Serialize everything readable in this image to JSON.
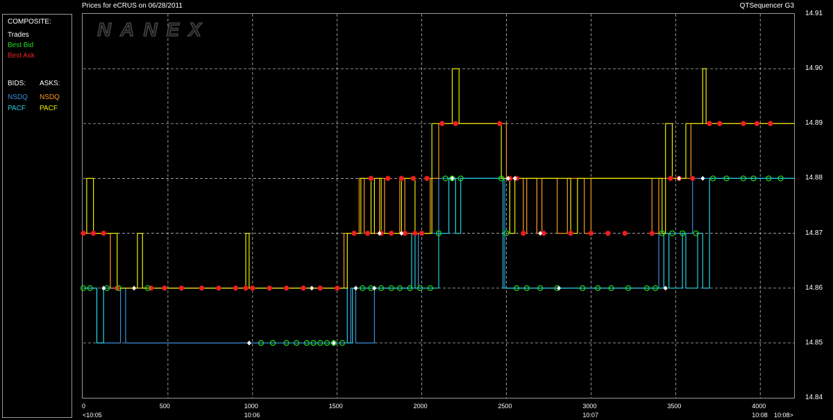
{
  "header": {
    "title_left": "Prices for  eCRUS  on  06/28/2011",
    "title_right": "QTSequencer G3"
  },
  "watermark": "NANEX",
  "legend": {
    "composite_title": "COMPOSITE:",
    "trades": "Trades",
    "best_bid": "Best Bid",
    "best_ask": "Best Ask",
    "bids_title": "BIDS:",
    "asks_title": "ASKS:",
    "bid_nsdq": "NSDQ",
    "bid_pacf": "PACF",
    "ask_nsdq": "NSDQ",
    "ask_pacf": "PACF"
  },
  "colors": {
    "trades": "#ffffff",
    "best_bid": "#22dd22",
    "best_ask": "#ee2222",
    "bid_nsdq": "#3a8fe0",
    "bid_pacf": "#22d0e0",
    "ask_nsdq": "#ff9a22",
    "ask_pacf": "#f0f000"
  },
  "chart_data": {
    "type": "line",
    "title": "Prices for  eCRUS  on  06/28/2011",
    "xlim": [
      0,
      4200
    ],
    "ylim": [
      14.84,
      14.91
    ],
    "grid": true,
    "y_ticks": [
      "14.84",
      "14.85",
      "14.86",
      "14.87",
      "14.88",
      "14.89",
      "14.90",
      "14.91"
    ],
    "x_ticks": [
      {
        "value": 0,
        "label": "0",
        "time": "<10:05"
      },
      {
        "value": 500,
        "label": "500",
        "time": ""
      },
      {
        "value": 1000,
        "label": "1000",
        "time": "10:06"
      },
      {
        "value": 1500,
        "label": "1500",
        "time": ""
      },
      {
        "value": 2000,
        "label": "2000",
        "time": ""
      },
      {
        "value": 2500,
        "label": "2500",
        "time": ""
      },
      {
        "value": 3000,
        "label": "3000",
        "time": "10:07"
      },
      {
        "value": 3500,
        "label": "3500",
        "time": ""
      },
      {
        "value": 4000,
        "label": "4000",
        "time": "10:08"
      }
    ],
    "x_end_label": "10:08>",
    "series": [
      {
        "name": "NSDQ",
        "key": "bid_nsdq",
        "points": [
          [
            0,
            14.86
          ],
          [
            80,
            14.86
          ],
          [
            80,
            14.85
          ],
          [
            220,
            14.85
          ],
          [
            220,
            14.86
          ],
          [
            250,
            14.86
          ],
          [
            250,
            14.85
          ],
          [
            1580,
            14.85
          ],
          [
            1580,
            14.86
          ],
          [
            1610,
            14.86
          ],
          [
            1610,
            14.85
          ],
          [
            1720,
            14.85
          ],
          [
            1720,
            14.86
          ],
          [
            1980,
            14.86
          ],
          [
            1980,
            14.87
          ],
          [
            2050,
            14.87
          ],
          [
            2050,
            14.87
          ],
          [
            2100,
            14.87
          ],
          [
            2100,
            14.88
          ],
          [
            2490,
            14.88
          ],
          [
            2490,
            14.86
          ],
          [
            2520,
            14.86
          ],
          [
            3400,
            14.86
          ],
          [
            3400,
            14.87
          ],
          [
            3600,
            14.87
          ],
          [
            3600,
            14.88
          ],
          [
            4200,
            14.88
          ]
        ]
      },
      {
        "name": "PACF",
        "key": "bid_pacf",
        "points": [
          [
            0,
            14.86
          ],
          [
            80,
            14.86
          ],
          [
            80,
            14.85
          ],
          [
            120,
            14.85
          ],
          [
            120,
            14.86
          ],
          [
            1560,
            14.86
          ],
          [
            1560,
            14.85
          ],
          [
            1590,
            14.85
          ],
          [
            1590,
            14.86
          ],
          [
            1940,
            14.86
          ],
          [
            1940,
            14.87
          ],
          [
            1960,
            14.87
          ],
          [
            1960,
            14.86
          ],
          [
            2100,
            14.86
          ],
          [
            2100,
            14.87
          ],
          [
            2160,
            14.87
          ],
          [
            2160,
            14.88
          ],
          [
            2200,
            14.88
          ],
          [
            2200,
            14.87
          ],
          [
            2230,
            14.87
          ],
          [
            2230,
            14.88
          ],
          [
            2480,
            14.88
          ],
          [
            2480,
            14.86
          ],
          [
            3430,
            14.86
          ],
          [
            3430,
            14.87
          ],
          [
            3460,
            14.87
          ],
          [
            3460,
            14.86
          ],
          [
            3540,
            14.86
          ],
          [
            3540,
            14.87
          ],
          [
            3560,
            14.87
          ],
          [
            3560,
            14.86
          ],
          [
            3630,
            14.86
          ],
          [
            3630,
            14.87
          ],
          [
            3660,
            14.87
          ],
          [
            3660,
            14.86
          ],
          [
            3700,
            14.86
          ],
          [
            3700,
            14.88
          ],
          [
            4200,
            14.88
          ]
        ]
      },
      {
        "name": "NSDQ",
        "key": "ask_nsdq",
        "points": [
          [
            0,
            14.87
          ],
          [
            160,
            14.87
          ],
          [
            160,
            14.86
          ],
          [
            1540,
            14.86
          ],
          [
            1540,
            14.87
          ],
          [
            1630,
            14.87
          ],
          [
            1630,
            14.88
          ],
          [
            1660,
            14.88
          ],
          [
            1660,
            14.87
          ],
          [
            1750,
            14.87
          ],
          [
            1750,
            14.88
          ],
          [
            1780,
            14.88
          ],
          [
            1780,
            14.87
          ],
          [
            1870,
            14.87
          ],
          [
            1870,
            14.88
          ],
          [
            1900,
            14.88
          ],
          [
            1900,
            14.87
          ],
          [
            2050,
            14.87
          ],
          [
            2050,
            14.88
          ],
          [
            2100,
            14.88
          ],
          [
            2100,
            14.89
          ],
          [
            2500,
            14.89
          ],
          [
            2500,
            14.88
          ],
          [
            2600,
            14.88
          ],
          [
            2600,
            14.87
          ],
          [
            2620,
            14.87
          ],
          [
            2620,
            14.88
          ],
          [
            2680,
            14.88
          ],
          [
            2680,
            14.87
          ],
          [
            2710,
            14.87
          ],
          [
            2710,
            14.88
          ],
          [
            2800,
            14.88
          ],
          [
            2800,
            14.87
          ],
          [
            2860,
            14.87
          ],
          [
            2860,
            14.88
          ],
          [
            2960,
            14.88
          ],
          [
            2960,
            14.87
          ],
          [
            3000,
            14.87
          ],
          [
            3000,
            14.88
          ],
          [
            3360,
            14.88
          ],
          [
            3360,
            14.87
          ],
          [
            3400,
            14.87
          ],
          [
            3400,
            14.88
          ],
          [
            3590,
            14.88
          ],
          [
            3590,
            14.89
          ],
          [
            4200,
            14.89
          ]
        ]
      },
      {
        "name": "PACF",
        "key": "ask_pacf",
        "points": [
          [
            0,
            14.87
          ],
          [
            20,
            14.87
          ],
          [
            20,
            14.88
          ],
          [
            60,
            14.88
          ],
          [
            60,
            14.87
          ],
          [
            200,
            14.87
          ],
          [
            200,
            14.86
          ],
          [
            320,
            14.86
          ],
          [
            320,
            14.87
          ],
          [
            350,
            14.87
          ],
          [
            350,
            14.86
          ],
          [
            960,
            14.86
          ],
          [
            960,
            14.87
          ],
          [
            980,
            14.87
          ],
          [
            980,
            14.86
          ],
          [
            1560,
            14.86
          ],
          [
            1560,
            14.87
          ],
          [
            1640,
            14.87
          ],
          [
            1640,
            14.88
          ],
          [
            1700,
            14.88
          ],
          [
            1700,
            14.87
          ],
          [
            1720,
            14.87
          ],
          [
            1720,
            14.88
          ],
          [
            1760,
            14.88
          ],
          [
            1760,
            14.87
          ],
          [
            1880,
            14.87
          ],
          [
            1880,
            14.88
          ],
          [
            1960,
            14.88
          ],
          [
            1960,
            14.87
          ],
          [
            2060,
            14.87
          ],
          [
            2060,
            14.89
          ],
          [
            2180,
            14.89
          ],
          [
            2180,
            14.9
          ],
          [
            2220,
            14.9
          ],
          [
            2220,
            14.89
          ],
          [
            2470,
            14.89
          ],
          [
            2470,
            14.88
          ],
          [
            2520,
            14.88
          ],
          [
            2520,
            14.87
          ],
          [
            2550,
            14.87
          ],
          [
            2550,
            14.88
          ],
          [
            2880,
            14.88
          ],
          [
            2880,
            14.87
          ],
          [
            2920,
            14.87
          ],
          [
            2920,
            14.88
          ],
          [
            3420,
            14.88
          ],
          [
            3420,
            14.87
          ],
          [
            3440,
            14.87
          ],
          [
            3440,
            14.89
          ],
          [
            3480,
            14.89
          ],
          [
            3480,
            14.88
          ],
          [
            3560,
            14.88
          ],
          [
            3560,
            14.89
          ],
          [
            3660,
            14.89
          ],
          [
            3660,
            14.9
          ],
          [
            3680,
            14.9
          ],
          [
            3680,
            14.89
          ],
          [
            4200,
            14.89
          ]
        ]
      }
    ],
    "best_bid_markers": [
      [
        0,
        14.86
      ],
      [
        40,
        14.86
      ],
      [
        140,
        14.86
      ],
      [
        210,
        14.86
      ],
      [
        380,
        14.86
      ],
      [
        1050,
        14.85
      ],
      [
        1120,
        14.85
      ],
      [
        1200,
        14.85
      ],
      [
        1260,
        14.85
      ],
      [
        1320,
        14.85
      ],
      [
        1360,
        14.85
      ],
      [
        1400,
        14.85
      ],
      [
        1440,
        14.85
      ],
      [
        1480,
        14.85
      ],
      [
        1530,
        14.85
      ],
      [
        1650,
        14.86
      ],
      [
        1700,
        14.86
      ],
      [
        1760,
        14.86
      ],
      [
        1820,
        14.86
      ],
      [
        1870,
        14.86
      ],
      [
        1930,
        14.86
      ],
      [
        1990,
        14.86
      ],
      [
        2050,
        14.86
      ],
      [
        2100,
        14.87
      ],
      [
        2140,
        14.88
      ],
      [
        2180,
        14.88
      ],
      [
        2230,
        14.88
      ],
      [
        2470,
        14.88
      ],
      [
        2500,
        14.87
      ],
      [
        2560,
        14.86
      ],
      [
        2620,
        14.86
      ],
      [
        2700,
        14.86
      ],
      [
        2800,
        14.86
      ],
      [
        2950,
        14.86
      ],
      [
        3040,
        14.86
      ],
      [
        3120,
        14.86
      ],
      [
        3220,
        14.86
      ],
      [
        3330,
        14.86
      ],
      [
        3380,
        14.86
      ],
      [
        3420,
        14.87
      ],
      [
        3480,
        14.87
      ],
      [
        3540,
        14.87
      ],
      [
        3620,
        14.87
      ],
      [
        3720,
        14.88
      ],
      [
        3800,
        14.88
      ],
      [
        3900,
        14.88
      ],
      [
        3960,
        14.88
      ],
      [
        4050,
        14.88
      ],
      [
        4120,
        14.88
      ]
    ],
    "best_ask_markers": [
      [
        0,
        14.87
      ],
      [
        60,
        14.87
      ],
      [
        120,
        14.87
      ],
      [
        200,
        14.86
      ],
      [
        400,
        14.86
      ],
      [
        480,
        14.86
      ],
      [
        580,
        14.86
      ],
      [
        700,
        14.86
      ],
      [
        800,
        14.86
      ],
      [
        900,
        14.86
      ],
      [
        960,
        14.86
      ],
      [
        1000,
        14.86
      ],
      [
        1100,
        14.86
      ],
      [
        1200,
        14.86
      ],
      [
        1300,
        14.86
      ],
      [
        1400,
        14.86
      ],
      [
        1500,
        14.86
      ],
      [
        1600,
        14.87
      ],
      [
        1680,
        14.87
      ],
      [
        1760,
        14.87
      ],
      [
        1820,
        14.87
      ],
      [
        1900,
        14.87
      ],
      [
        1960,
        14.87
      ],
      [
        2000,
        14.87
      ],
      [
        1700,
        14.88
      ],
      [
        1800,
        14.88
      ],
      [
        1880,
        14.88
      ],
      [
        1950,
        14.88
      ],
      [
        2030,
        14.88
      ],
      [
        2120,
        14.89
      ],
      [
        2200,
        14.89
      ],
      [
        2460,
        14.89
      ],
      [
        2520,
        14.88
      ],
      [
        2560,
        14.88
      ],
      [
        2600,
        14.87
      ],
      [
        2720,
        14.87
      ],
      [
        2880,
        14.87
      ],
      [
        3000,
        14.87
      ],
      [
        3100,
        14.87
      ],
      [
        3200,
        14.87
      ],
      [
        3360,
        14.87
      ],
      [
        3470,
        14.88
      ],
      [
        3520,
        14.88
      ],
      [
        3600,
        14.88
      ],
      [
        3700,
        14.89
      ],
      [
        3760,
        14.89
      ],
      [
        3900,
        14.89
      ],
      [
        3980,
        14.89
      ],
      [
        4060,
        14.89
      ]
    ],
    "trade_markers": [
      [
        120,
        14.86
      ],
      [
        300,
        14.86
      ],
      [
        980,
        14.85
      ],
      [
        1350,
        14.86
      ],
      [
        1480,
        14.85
      ],
      [
        1610,
        14.86
      ],
      [
        1720,
        14.86
      ],
      [
        1750,
        14.87
      ],
      [
        1880,
        14.87
      ],
      [
        2180,
        14.88
      ],
      [
        2510,
        14.88
      ],
      [
        2550,
        14.88
      ],
      [
        2700,
        14.87
      ],
      [
        2810,
        14.86
      ],
      [
        3440,
        14.86
      ],
      [
        3520,
        14.88
      ],
      [
        3660,
        14.88
      ]
    ]
  }
}
